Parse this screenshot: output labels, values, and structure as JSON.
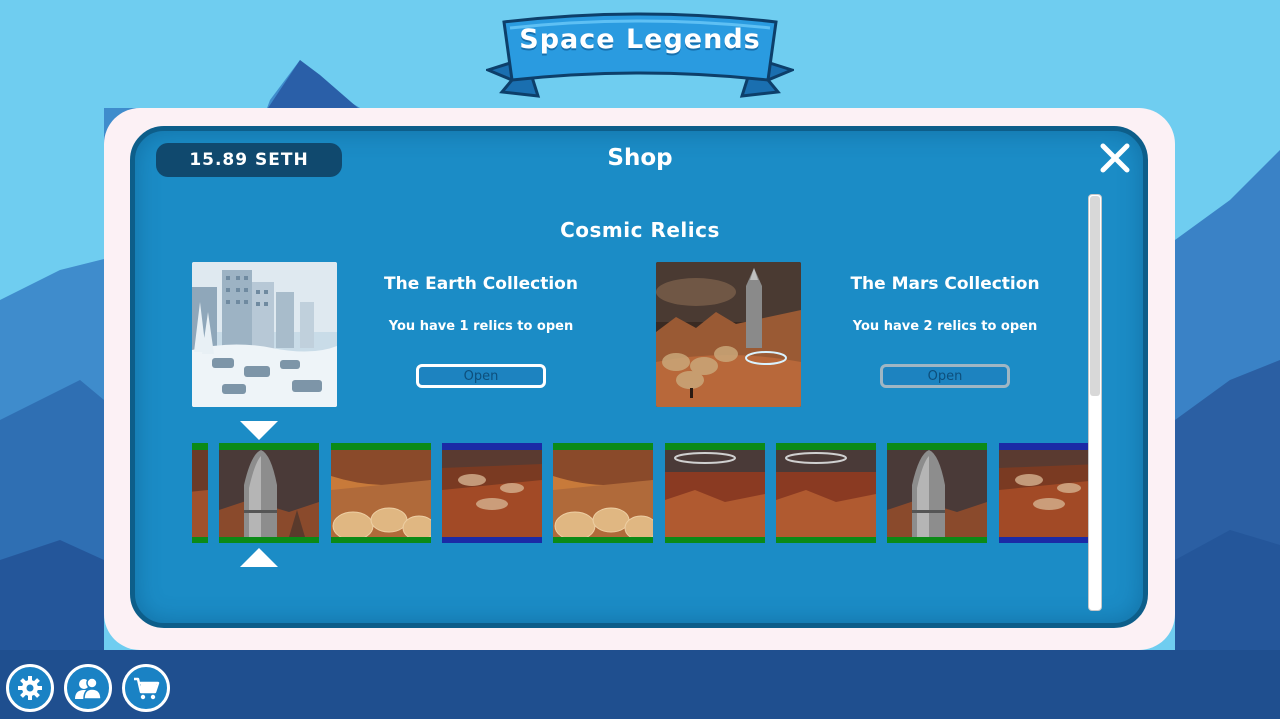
{
  "game": {
    "title": "Space Legends"
  },
  "shop": {
    "balance": "15.89 SETH",
    "title": "Shop",
    "section_title": "Cosmic Relics",
    "collections": [
      {
        "name": "The Earth Collection",
        "relics_text": "You have 1 relics to open",
        "open_label": "Open",
        "selected": true
      },
      {
        "name": "The Mars Collection",
        "relics_text": "You have 2 relics to open",
        "open_label": "Open",
        "selected": false
      }
    ],
    "carousel": {
      "cards": [
        {
          "image": "mars-partial",
          "rarity_color": "#0b8a17"
        },
        {
          "image": "rocket",
          "rarity_color": "#0b8a17"
        },
        {
          "image": "domes",
          "rarity_color": "#0b8a17"
        },
        {
          "image": "colony",
          "rarity_color": "#1b2aa6"
        },
        {
          "image": "domes",
          "rarity_color": "#0b8a17"
        },
        {
          "image": "landscape",
          "rarity_color": "#0b8a17"
        },
        {
          "image": "landscape",
          "rarity_color": "#0b8a17"
        },
        {
          "image": "rocket",
          "rarity_color": "#0b8a17"
        },
        {
          "image": "colony",
          "rarity_color": "#1b2aa6"
        }
      ]
    }
  },
  "bottom_bar": {
    "buttons": [
      {
        "icon": "gear-icon"
      },
      {
        "icon": "friends-icon"
      },
      {
        "icon": "cart-icon"
      }
    ]
  },
  "colors": {
    "panel": "#1b8cc6",
    "frame": "#fcf1f5",
    "accent": "#0d5e8a",
    "sky": "#6fcdf0"
  }
}
